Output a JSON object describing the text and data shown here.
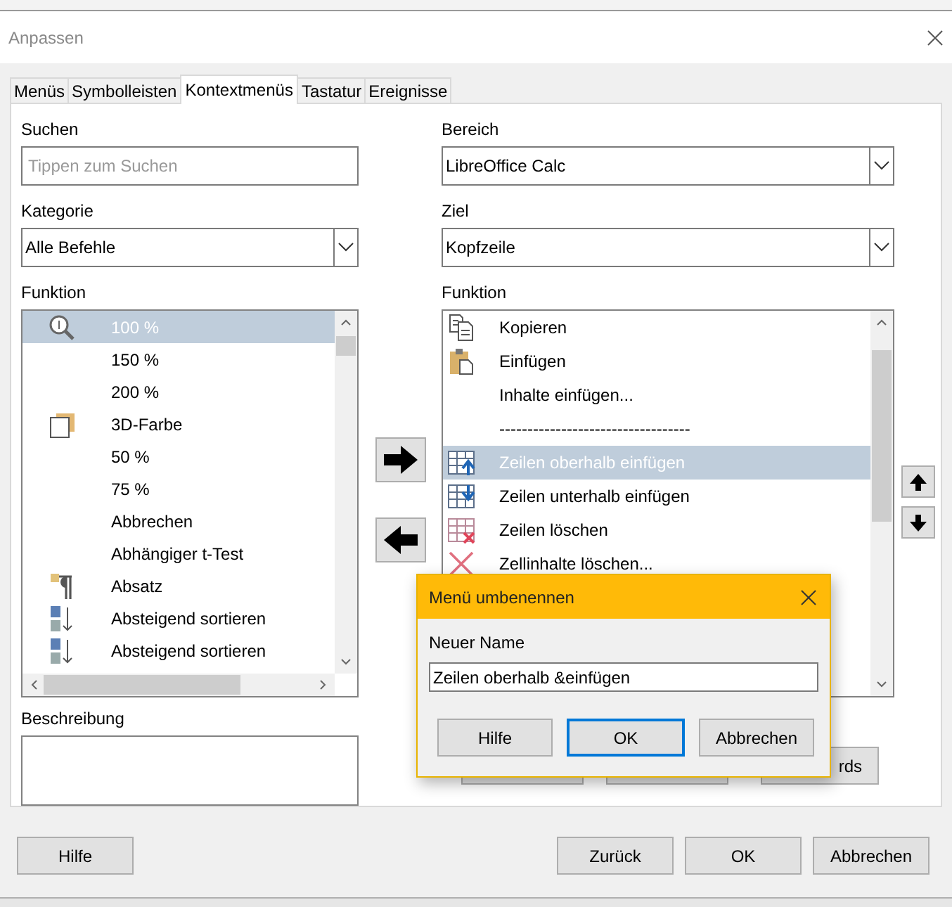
{
  "window": {
    "title": "Anpassen"
  },
  "tabs": [
    {
      "label": "Menüs",
      "selected": false
    },
    {
      "label": "Symbolleisten",
      "selected": false
    },
    {
      "label": "Kontextmenüs",
      "selected": true
    },
    {
      "label": "Tastatur",
      "selected": false
    },
    {
      "label": "Ereignisse",
      "selected": false
    }
  ],
  "search": {
    "label": "Suchen",
    "placeholder": "Tippen zum Suchen"
  },
  "category": {
    "label": "Kategorie",
    "value": "Alle Befehle"
  },
  "functions": {
    "label": "Funktion",
    "items": [
      {
        "label": "100 %",
        "selected": true
      },
      {
        "label": "150 %",
        "selected": false
      },
      {
        "label": "200 %",
        "selected": false
      },
      {
        "label": "3D-Farbe",
        "selected": false
      },
      {
        "label": "50 %",
        "selected": false
      },
      {
        "label": "75 %",
        "selected": false
      },
      {
        "label": "Abbrechen",
        "selected": false
      },
      {
        "label": "Abhängiger t-Test",
        "selected": false
      },
      {
        "label": "Absatz",
        "selected": false
      },
      {
        "label": "Absteigend sortieren",
        "selected": false
      },
      {
        "label": "Absteigend sortieren",
        "selected": false
      }
    ]
  },
  "description": {
    "label": "Beschreibung"
  },
  "scope": {
    "label": "Bereich",
    "value": "LibreOffice Calc"
  },
  "target": {
    "label": "Ziel",
    "value": "Kopfzeile"
  },
  "entries": {
    "label": "Funktion",
    "items": [
      {
        "label": "Kopieren",
        "selected": false
      },
      {
        "label": "Einfügen",
        "selected": false
      },
      {
        "label": "Inhalte einfügen...",
        "selected": false
      },
      {
        "label": "----------------------------------",
        "selected": false
      },
      {
        "label": "Zeilen oberhalb einfügen",
        "selected": true
      },
      {
        "label": "Zeilen unterhalb einfügen",
        "selected": false
      },
      {
        "label": "Zeilen löschen",
        "selected": false
      },
      {
        "label": "Zellinhalte löschen...",
        "selected": false
      }
    ]
  },
  "entry_buttons": [
    "rds"
  ],
  "buttons": [
    {
      "label": "Hilfe"
    },
    {
      "label": "Zurück"
    },
    {
      "label": "OK"
    },
    {
      "label": "Abbrechen"
    }
  ],
  "rename_dialog": {
    "title": "Menü umbenennen",
    "field_label": "Neuer Name",
    "value": "Zeilen oberhalb &einfügen",
    "buttons": [
      {
        "label": "Hilfe",
        "focused": false
      },
      {
        "label": "OK",
        "focused": true
      },
      {
        "label": "Abbrechen",
        "focused": false
      }
    ]
  }
}
